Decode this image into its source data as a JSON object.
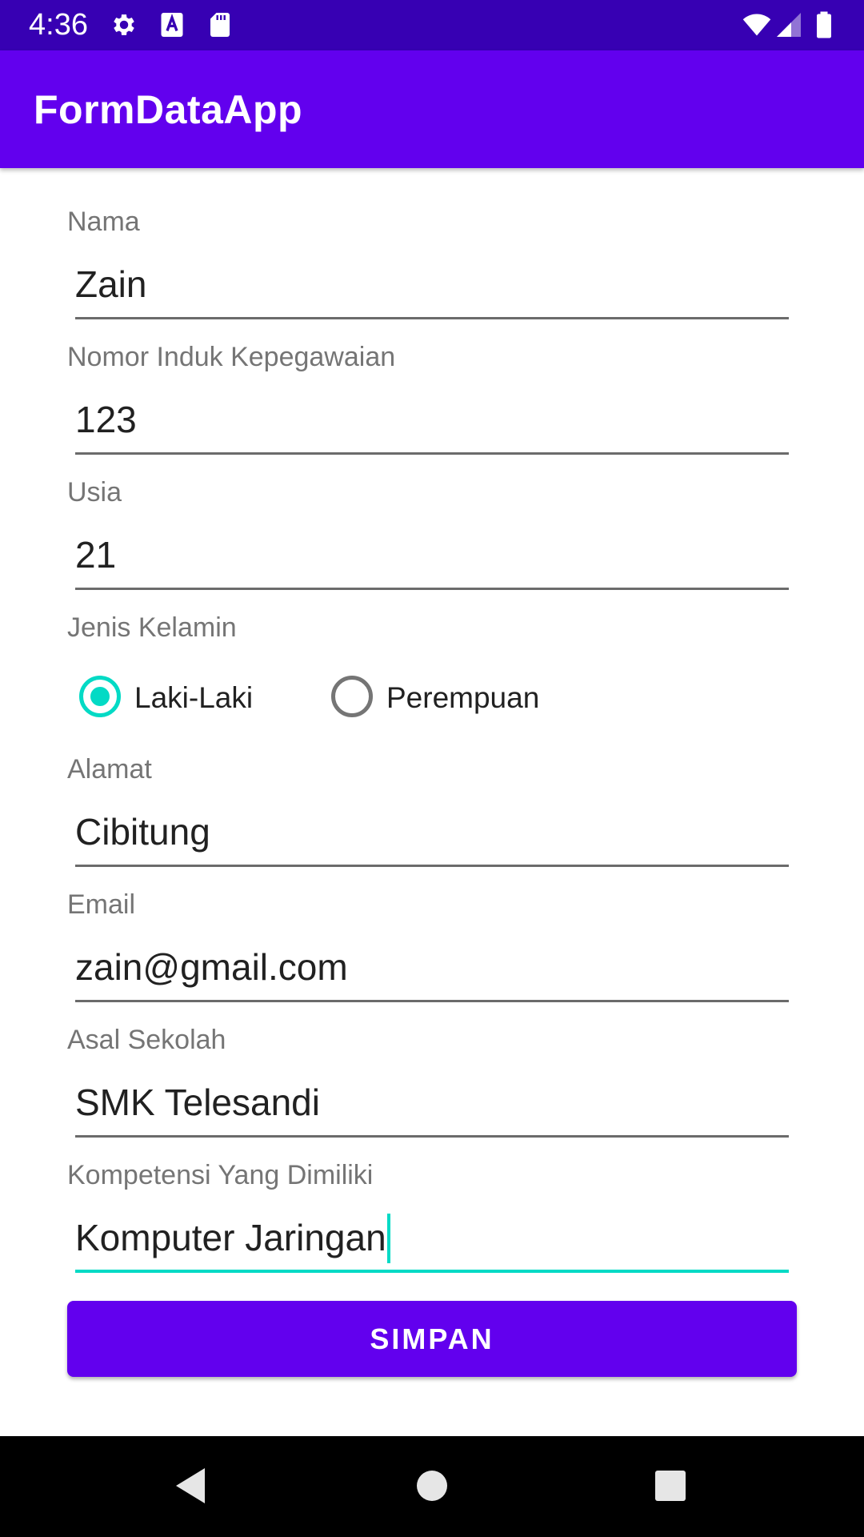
{
  "status_bar": {
    "time": "4:36",
    "icons": [
      "gear-icon",
      "text-a-icon",
      "sd-card-icon",
      "wifi-icon",
      "signal-icon",
      "battery-icon"
    ],
    "color": "#3700B3"
  },
  "app_bar": {
    "title": "FormDataApp",
    "color": "#6200EE"
  },
  "form": {
    "fields": [
      {
        "label": "Nama",
        "value": "Zain"
      },
      {
        "label": "Nomor Induk Kepegawaian",
        "value": "123"
      },
      {
        "label": "Usia",
        "value": "21"
      },
      {
        "label": "Jenis Kelamin"
      },
      {
        "label": "Alamat",
        "value": "Cibitung"
      },
      {
        "label": "Email",
        "value": "zain@gmail.com"
      },
      {
        "label": "Asal Sekolah",
        "value": "SMK Telesandi"
      },
      {
        "label": "Kompetensi Yang Dimiliki",
        "value": "Komputer Jaringan"
      }
    ],
    "gender_options": [
      {
        "label": "Laki-Laki",
        "checked": true
      },
      {
        "label": "Perempuan",
        "checked": false
      }
    ],
    "focused_field": "Kompetensi Yang Dimiliki",
    "accent_color": "#03DAC5"
  },
  "save_button": {
    "label": "SIMPAN"
  },
  "nav_bar": {
    "icons": [
      "back-icon",
      "home-icon",
      "recents-icon"
    ]
  }
}
